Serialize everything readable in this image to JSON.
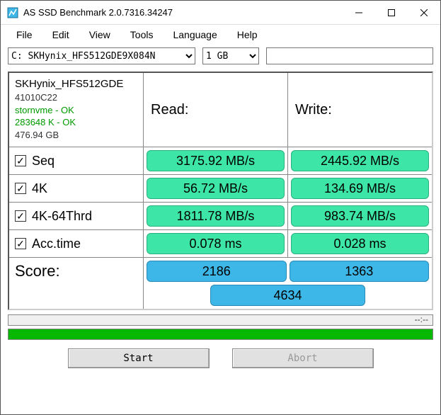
{
  "window": {
    "title": "AS SSD Benchmark 2.0.7316.34247"
  },
  "menu": {
    "file": "File",
    "edit": "Edit",
    "view": "View",
    "tools": "Tools",
    "language": "Language",
    "help": "Help"
  },
  "controls": {
    "drive": "C: SKHynix_HFS512GDE9X084N",
    "size": "1 GB",
    "textbox": ""
  },
  "driveinfo": {
    "name": "SKHynix_HFS512GDE",
    "firmware": "41010C22",
    "driver_ok": "stornvme - OK",
    "align_ok": "283648 K - OK",
    "capacity": "476.94 GB"
  },
  "headers": {
    "read": "Read:",
    "write": "Write:"
  },
  "rows": {
    "seq": {
      "label": "Seq",
      "checked": true,
      "read": "3175.92 MB/s",
      "write": "2445.92 MB/s"
    },
    "k4": {
      "label": "4K",
      "checked": true,
      "read": "56.72 MB/s",
      "write": "134.69 MB/s"
    },
    "k464": {
      "label": "4K-64Thrd",
      "checked": true,
      "read": "1811.78 MB/s",
      "write": "983.74 MB/s"
    },
    "acc": {
      "label": "Acc.time",
      "checked": true,
      "read": "0.078 ms",
      "write": "0.028 ms"
    }
  },
  "score": {
    "label": "Score:",
    "read": "2186",
    "write": "1363",
    "total": "4634"
  },
  "progress": {
    "text": "--:--"
  },
  "buttons": {
    "start": "Start",
    "abort": "Abort"
  }
}
